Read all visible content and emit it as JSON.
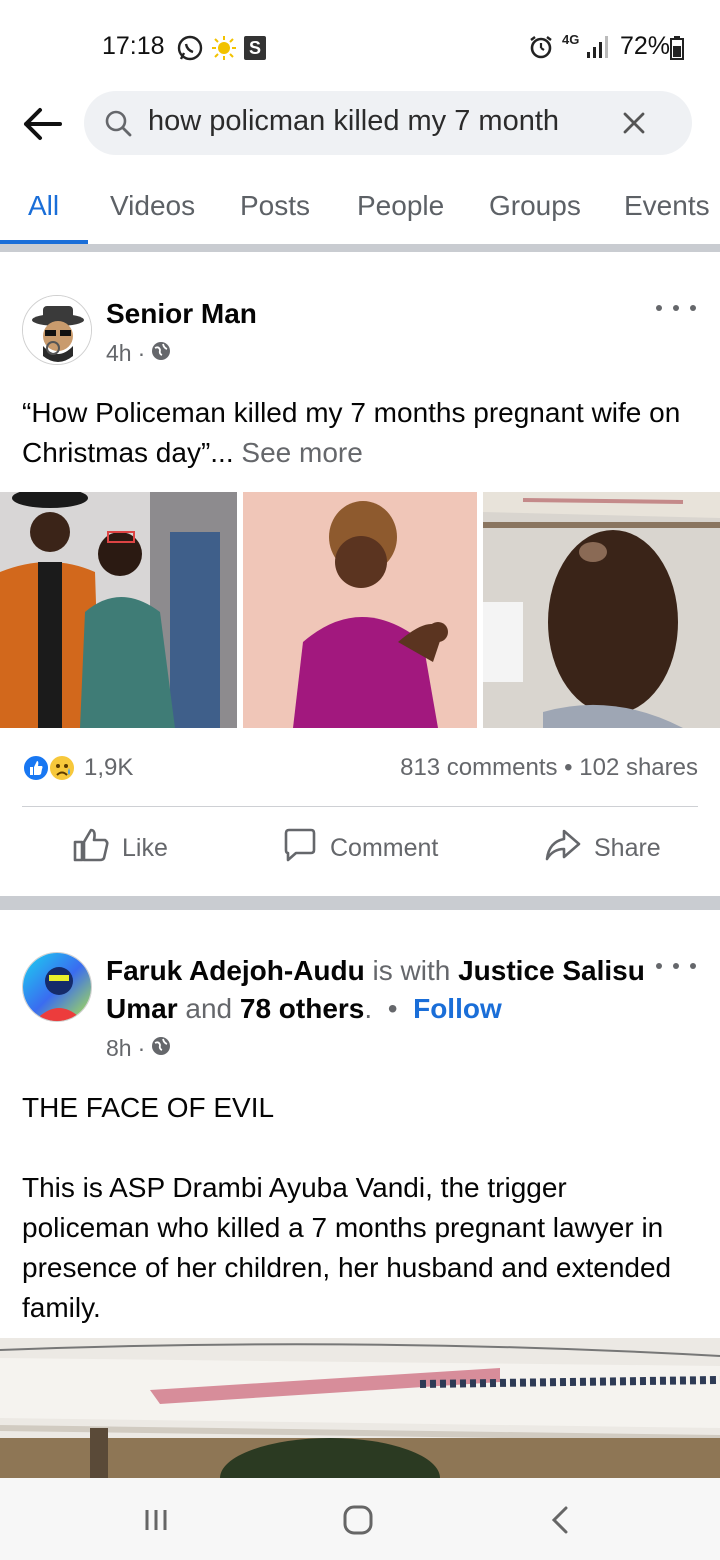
{
  "status_bar": {
    "time": "17:18",
    "s_badge": "S",
    "network": "4G",
    "battery": "72%"
  },
  "search": {
    "query": "how policman killed my 7 month",
    "icons": [
      "back-arrow-icon",
      "search-icon",
      "clear-icon"
    ]
  },
  "tabs": [
    {
      "label": "All",
      "active": true
    },
    {
      "label": "Videos"
    },
    {
      "label": "Posts"
    },
    {
      "label": "People"
    },
    {
      "label": "Groups"
    },
    {
      "label": "Events"
    }
  ],
  "post1": {
    "author": "Senior Man",
    "time": "4h",
    "text": "“How Policeman killed my 7 months pregnant wife on Christmas day”...",
    "see_more": "See more",
    "reaction_count": "1,9K",
    "comments": "813 comments",
    "shares": "102 shares",
    "actions": {
      "like": "Like",
      "comment": "Comment",
      "share": "Share"
    }
  },
  "post2": {
    "author": "Faruk Adejoh-Audu",
    "with_text": "is with",
    "tagged1": "Justice Salisu Umar",
    "and_text": "and",
    "tagged2": "78 others",
    "follow": "Follow",
    "time": "8h",
    "line1": "THE FACE OF EVIL",
    "body": "This is ASP Drambi Ayuba Vandi, the trigger policeman who killed a 7 months pregnant lawyer in presence of her children,  her husband and extended family."
  },
  "colors": {
    "accent": "#1a6ed8",
    "secondary_text": "#65676b",
    "divider": "#c9ccd1"
  }
}
